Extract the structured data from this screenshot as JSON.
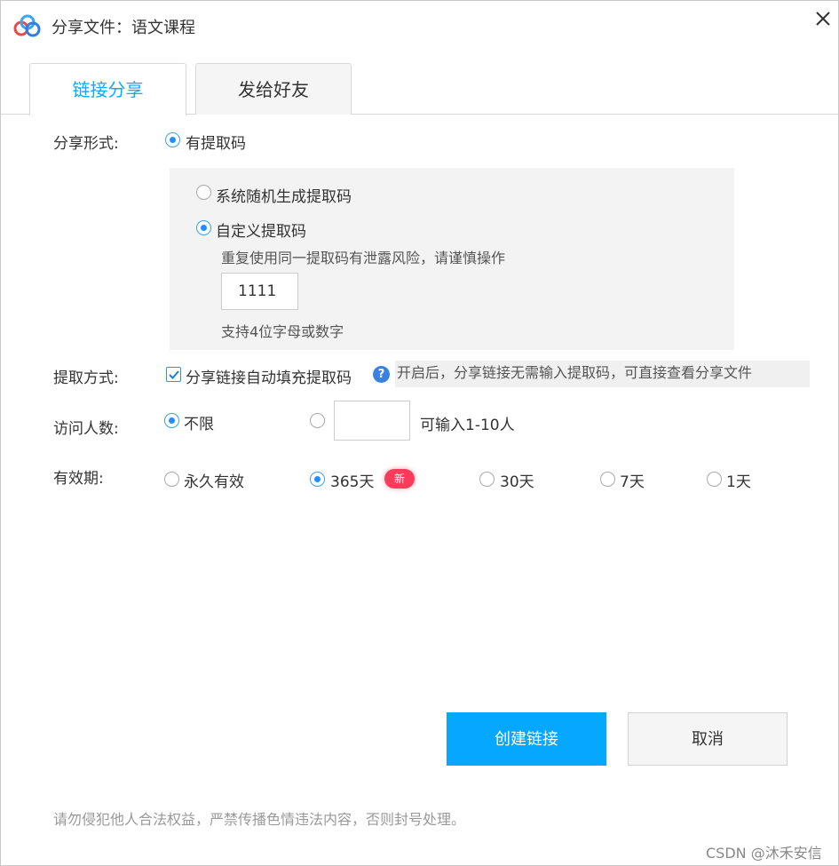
{
  "window": {
    "title": "分享文件：语文课程",
    "close_icon": "close-icon",
    "app_icon": "baidu-netdisk-logo"
  },
  "tabs": [
    {
      "label": "链接分享",
      "active": true
    },
    {
      "label": "发给好友",
      "active": false
    }
  ],
  "share_form": {
    "label": "分享形式:",
    "option": "有提取码",
    "selected": true
  },
  "code_panel": {
    "random_option": "系统随机生成提取码",
    "custom_option": "自定义提取码",
    "custom_selected": true,
    "warning": "重复使用同一提取码有泄露风险，请谨慎操作",
    "code_value": "1111",
    "hint": "支持4位字母或数字"
  },
  "extract_method": {
    "label": "提取方式:",
    "checkbox_label": "分享链接自动填充提取码",
    "checked": true,
    "tooltip": "开启后，分享链接无需输入提取码，可直接查看分享文件"
  },
  "visitors": {
    "label": "访问人数:",
    "unlimited_option": "不限",
    "unlimited_selected": true,
    "custom_hint": "可输入1-10人",
    "custom_value": ""
  },
  "validity": {
    "label": "有效期:",
    "options": [
      "永久有效",
      "365天",
      "30天",
      "7天",
      "1天"
    ],
    "selected": "365天",
    "new_badge": "新"
  },
  "buttons": {
    "create": "创建链接",
    "cancel": "取消"
  },
  "footer_note": "请勿侵犯他人合法权益，严禁传播色情违法内容，否则封号处理。",
  "watermark": "CSDN @沐禾安信",
  "colors": {
    "accent": "#06a7ff",
    "tab_active_text": "#09aaff",
    "badge": "#ff3b5c"
  }
}
